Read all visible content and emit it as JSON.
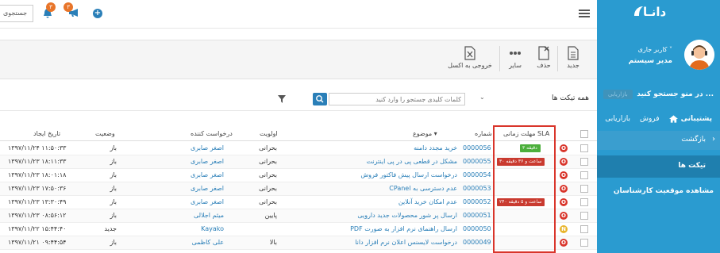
{
  "app": {
    "logo_text": "دانـا"
  },
  "user": {
    "role": "کاربر جاری",
    "name": "مدیر سیستم"
  },
  "sidebar": {
    "search_label": "در منو جستجو کنید ...",
    "search_chip": "بازاریابی",
    "tabs": [
      {
        "label": "پشتیبانی"
      },
      {
        "label": "فروش"
      },
      {
        "label": "بازاریابی"
      }
    ],
    "back_label": "بازگشت",
    "tickets_label": "تیکت ها",
    "agents_label": "مشاهده موقعیت کارشناسان"
  },
  "topbar": {
    "search_label": "جستجوی",
    "bell_count": "۳",
    "mega_count": "۳",
    "plus_symbol": "+"
  },
  "toolbar": {
    "new_label": "جدید",
    "delete_label": "حذف",
    "other_label": "سایر",
    "excel_label": "خروجی به اکسل"
  },
  "filters": {
    "view_label": "همه تیکت ها",
    "chevron": "⌄",
    "keyword_placeholder": "کلمات کلیدی جستجو را وارد کنید"
  },
  "table": {
    "headers": {
      "sla": "مهلت زمانی SLA",
      "number": "شماره",
      "subject": "موضوع",
      "priority": "اولویت",
      "requester": "درخواست کننده",
      "status": "وضعیت",
      "created": "تاریخ ایجاد"
    },
    "rows": [
      {
        "priority_icon": "O",
        "sla": "۳ دقیقه",
        "number": "0000056",
        "subject": "خرید مجدد دامنه",
        "priority": "بحرانی",
        "requester": "اصغر صابری",
        "status": "باز",
        "created": "۱۳۹۷/۱۱/۲۴ ۱۱:۵۰:۳۳"
      },
      {
        "priority_icon": "O",
        "sla": "۳۰ ساعت و ۳۶ دقیقه",
        "number": "0000055",
        "subject": "مشکل در قطعی پی در پی اینترنت",
        "priority": "بحرانی",
        "requester": "اصغر صابری",
        "status": "باز",
        "created": "۱۳۹۷/۱۱/۲۳ ۱۸:۱۱:۳۳"
      },
      {
        "priority_icon": "O",
        "sla": "",
        "number": "0000054",
        "subject": "درخواست ارسال پیش فاکتور فروش",
        "priority": "بحرانی",
        "requester": "اصغر صابری",
        "status": "باز",
        "created": "۱۳۹۷/۱۱/۲۳ ۱۸:۰۱:۱۸"
      },
      {
        "priority_icon": "O",
        "sla": "",
        "number": "0000053",
        "subject": "عدم دسترسی به CPanel",
        "priority": "بحرانی",
        "requester": "اصغر صابری",
        "status": "باز",
        "created": "۱۳۹۷/۱۱/۲۳ ۱۷:۵۰:۳۶"
      },
      {
        "priority_icon": "O",
        "sla": "۲۴۰ ساعت و ۵ دقیقه",
        "number": "0000052",
        "subject": "عدم امکان خرید آنلاین",
        "priority": "بحرانی",
        "requester": "اصغر صابری",
        "status": "باز",
        "created": "۱۳۹۷/۱۱/۲۳ ۱۳:۳۰:۴۹"
      },
      {
        "priority_icon": "O",
        "sla": "",
        "number": "0000051",
        "subject": "ارسال پر شور محصولات جدید دارویی",
        "priority": "پایین",
        "requester": "میثم اجلالی",
        "status": "باز",
        "created": "۱۳۹۷/۱۱/۲۳ ۰۸:۵۶:۱۲"
      },
      {
        "priority_icon": "N",
        "sla": "",
        "number": "0000050",
        "subject": "ارسال راهنمای نرم افزار به صورت PDF",
        "priority": "",
        "requester": "Kayako",
        "status": "جدید",
        "created": "۱۳۹۷/۱۱/۲۲ ۱۵:۴۴:۴۰"
      },
      {
        "priority_icon": "O",
        "sla": "",
        "number": "0000049",
        "subject": "درخواست لایسنس اعلان نرم افزار دانا",
        "priority": "بالا",
        "requester": "علی کاظمی",
        "status": "باز",
        "created": "۱۳۹۷/۱۱/۲۱ ۰۹:۴۴:۵۴"
      }
    ]
  },
  "colors": {
    "sidebar": "#2a9bd0",
    "accent": "#2a7fb8",
    "open_icon": "#d9352b",
    "new_icon": "#e8b42a",
    "sla_green": "#4caf3c",
    "sla_red": "#c93a2f",
    "highlight_box": "#d9352b"
  }
}
